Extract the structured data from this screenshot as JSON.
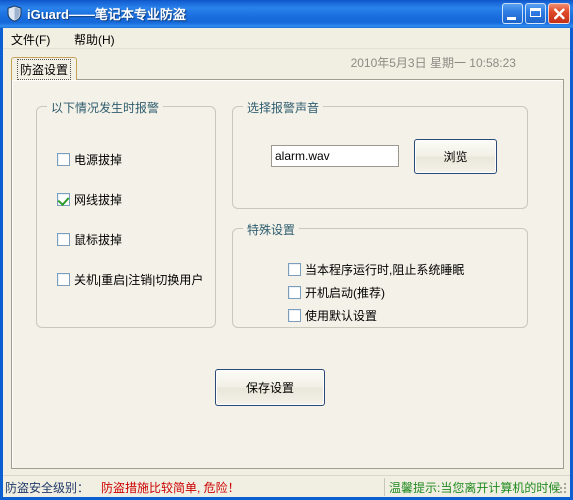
{
  "window": {
    "title": "iGuard——笔记本专业防盗",
    "icon": "shield-icon",
    "buttons": {
      "minimize": "minimize-icon",
      "maximize": "maximize-icon",
      "close": "close-icon"
    },
    "accent_color": "#1a72de"
  },
  "menu": {
    "items": [
      {
        "label": "文件(F)"
      },
      {
        "label": "帮助(H)"
      }
    ]
  },
  "header": {
    "datetime": "2010年5月3日 星期一 10:58:23"
  },
  "tabs": [
    {
      "label": "防盗设置",
      "selected": true
    }
  ],
  "alarm_group": {
    "title": "以下情况发生时报警",
    "items": [
      {
        "label": "电源拔掉",
        "checked": false
      },
      {
        "label": "网线拔掉",
        "checked": true
      },
      {
        "label": "鼠标拔掉",
        "checked": false
      },
      {
        "label": "关机|重启|注销|切换用户",
        "checked": false
      }
    ]
  },
  "sound_group": {
    "title": "选择报警声音",
    "file_value": "alarm.wav",
    "file_placeholder": "",
    "browse_label": "浏览"
  },
  "special_group": {
    "title": "特殊设置",
    "items": [
      {
        "label": "当本程序运行时,阻止系统睡眠",
        "checked": false
      },
      {
        "label": "开机启动(推荐)",
        "checked": false
      },
      {
        "label": "使用默认设置",
        "checked": false
      }
    ]
  },
  "actions": {
    "save_label": "保存设置"
  },
  "statusbar": {
    "level_label": "防盗安全级别：",
    "level_value": "防盗措施比较简单, 危险！",
    "level_color": "#cc0000",
    "tip": "温馨提示:当您离开计算机的时候请锁定您的计算机",
    "tip_color": "#1f8a1f"
  }
}
